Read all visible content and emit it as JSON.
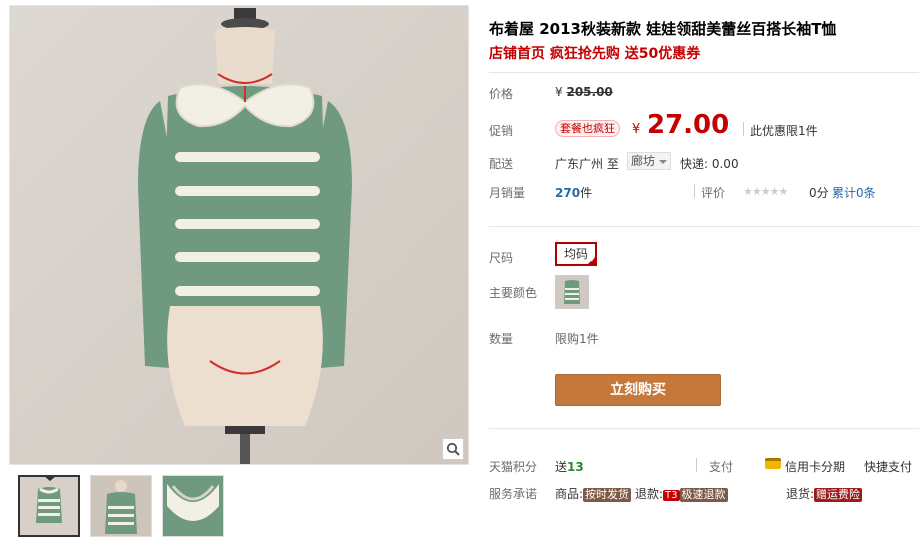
{
  "product": {
    "title": "布着屋 2013秋装新款 娃娃领甜美蕾丝百搭长袖T恤",
    "promo": "店铺首页 疯狂抢先购 送50优惠券"
  },
  "price": {
    "label": "价格",
    "currency": "¥",
    "original": "205.00"
  },
  "promotion": {
    "label": "促销",
    "tag": "套餐也疯狂",
    "currency": "¥",
    "value": "27.00",
    "limit": "此优惠限1件"
  },
  "shipping": {
    "label": "配送",
    "from": "广东广州 至",
    "to": "廊坊",
    "express": "快递: 0.00"
  },
  "sales": {
    "label": "月销量",
    "count": "270",
    "unit": "件",
    "rating_label": "评价",
    "stars": "★★★★★",
    "score": "0分",
    "reviews": "累计0条"
  },
  "options": {
    "size_label": "尺码",
    "size_value": "均码",
    "color_label": "主要颜色",
    "qty_label": "数量",
    "qty_limit": "限购1件"
  },
  "buy_button": "立刻购买",
  "points": {
    "label": "天猫积分",
    "prefix": "送",
    "value": "13"
  },
  "payment": {
    "label": "支付",
    "credit": "信用卡分期",
    "quick": "快捷支付"
  },
  "service": {
    "label": "服务承诺",
    "goods_prefix": "商品:",
    "goods_badge": "按时发货",
    "refund_prefix": "退款:",
    "refund_t3": "T3",
    "refund_badge": "极速退款",
    "return_prefix": "退货:",
    "return_badge": "赠运费险"
  },
  "colors": {
    "accent_red": "#c40000",
    "buy_button": "#c5783b",
    "link_blue": "#2968a8",
    "sweater_green": "#6f9a80",
    "lace_cream": "#f2efe6"
  },
  "icons": [
    "zoom-icon",
    "credit-card-icon",
    "checkmark-icon",
    "dropdown-arrow-icon"
  ]
}
